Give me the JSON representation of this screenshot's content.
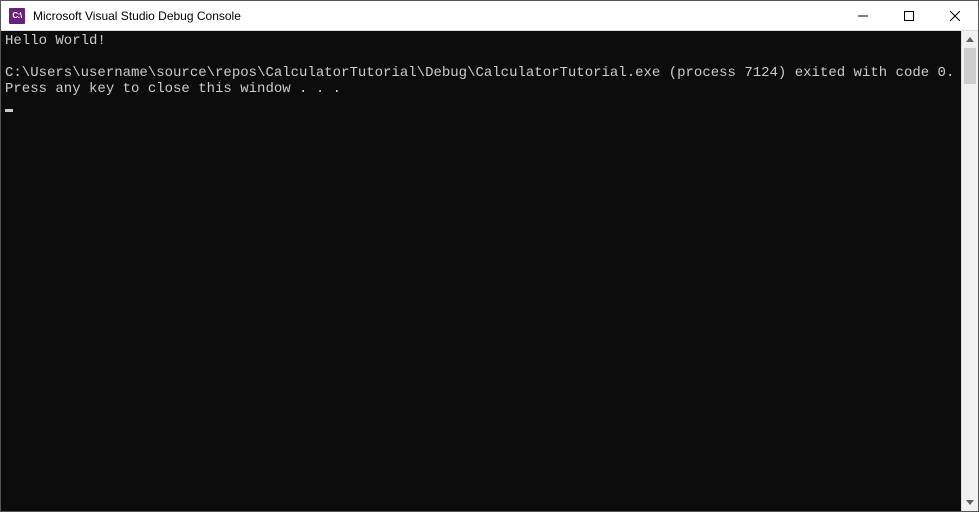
{
  "window": {
    "title": "Microsoft Visual Studio Debug Console",
    "icon_label": "C:\\"
  },
  "console": {
    "line1": "Hello World!",
    "line2": "",
    "line3": "C:\\Users\\username\\source\\repos\\CalculatorTutorial\\Debug\\CalculatorTutorial.exe (process 7124) exited with code 0.",
    "line4": "Press any key to close this window . . ."
  }
}
